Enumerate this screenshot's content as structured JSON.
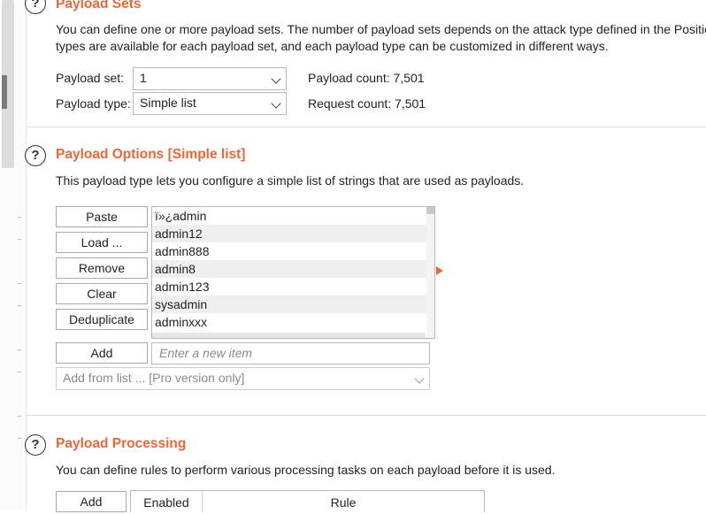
{
  "payload_sets": {
    "heading": "Payload Sets",
    "desc_line1": "You can define one or more payload sets. The number of payload sets depends on the attack type defined in the Positic",
    "desc_line2": "types are available for each payload set, and each payload type can be customized in different ways.",
    "set_label": "Payload set:",
    "set_value": "1",
    "type_label": "Payload type:",
    "type_value": "Simple list",
    "payload_count": "Payload count: 7,501",
    "request_count": "Request count: 7,501"
  },
  "payload_options": {
    "heading": "Payload Options [Simple list]",
    "desc": "This payload type lets you configure a simple list of strings that are used as payloads.",
    "buttons": {
      "paste": "Paste",
      "load": "Load ...",
      "remove": "Remove",
      "clear": "Clear",
      "deduplicate": "Deduplicate",
      "add": "Add"
    },
    "items": [
      "ï»¿admin",
      "admin12",
      "admin888",
      "admin8",
      "admin123",
      "sysadmin",
      "adminxxx"
    ],
    "new_item_placeholder": "Enter a new item",
    "add_from_list": "Add from list ... [Pro version only]"
  },
  "payload_processing": {
    "heading": "Payload Processing",
    "desc": "You can define rules to perform various processing tasks on each payload before it is used.",
    "add_button": "Add",
    "columns": [
      "Enabled",
      "Rule"
    ]
  },
  "colors": {
    "accent": "#e4693a"
  }
}
